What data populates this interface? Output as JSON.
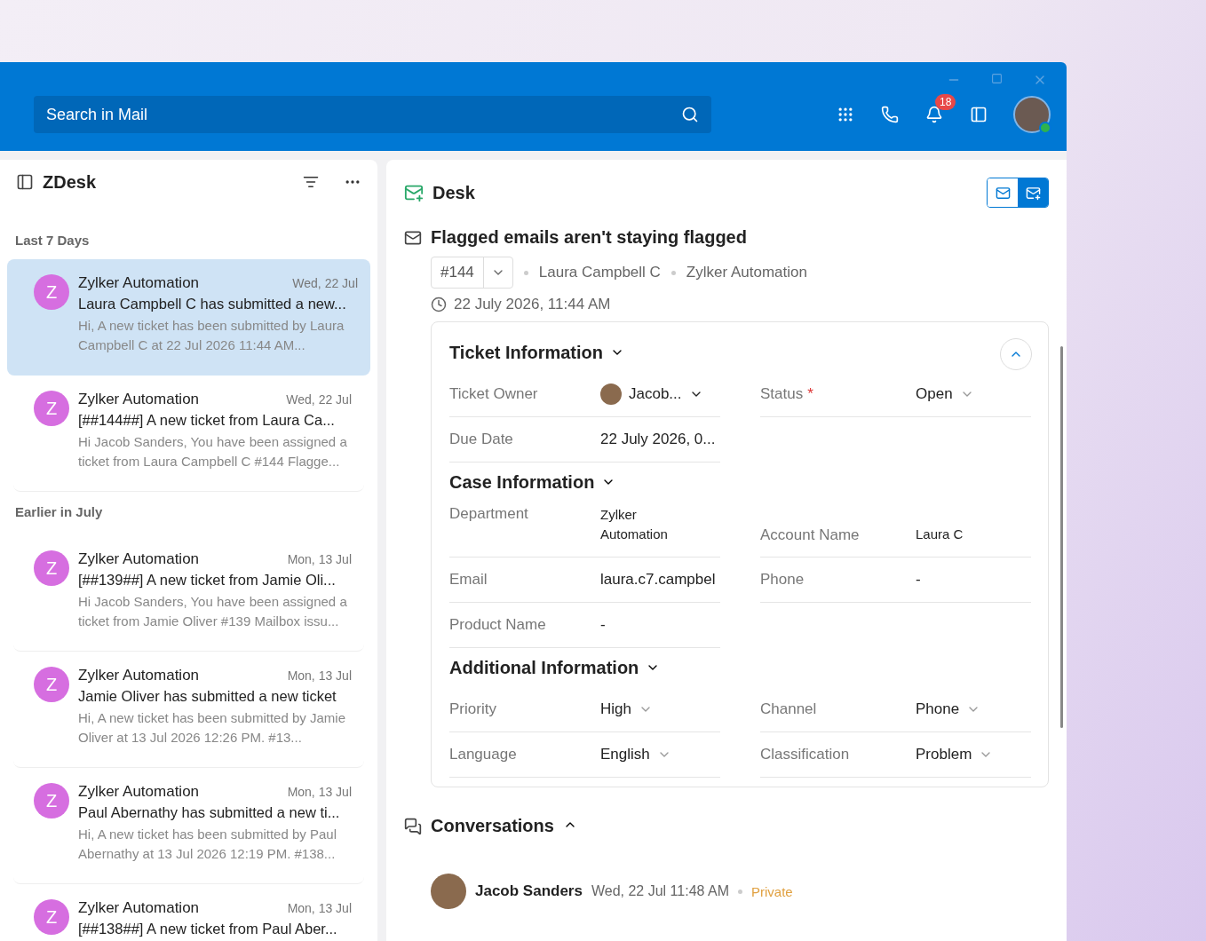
{
  "window": {
    "search": {
      "placeholder": "Search in Mail"
    },
    "notifications": {
      "count": "18"
    },
    "presence": {
      "online": true
    }
  },
  "folder": {
    "title": "ZDesk"
  },
  "mail_groups": [
    {
      "label": "Last 7 Days",
      "items": [
        {
          "avatar": "Z",
          "sender": "Zylker Automation",
          "date": "Wed, 22 Jul",
          "subject": "Laura Campbell C has submitted a new...",
          "preview": "Hi, A new ticket has been submitted by Laura Campbell C at 22 Jul 2026 11:44 AM...",
          "selected": true
        },
        {
          "avatar": "Z",
          "sender": "Zylker Automation",
          "date": "Wed, 22 Jul",
          "subject": "[##144##] A new ticket from Laura Ca...",
          "preview": "Hi Jacob Sanders, You have been assigned a ticket from Laura Campbell C #144 Flagge...",
          "selected": false
        }
      ]
    },
    {
      "label": "Earlier in July",
      "items": [
        {
          "avatar": "Z",
          "sender": "Zylker Automation",
          "date": "Mon, 13 Jul",
          "subject": "[##139##] A new ticket from Jamie Oli...",
          "preview": "Hi Jacob Sanders, You have been assigned a ticket from Jamie Oliver #139 Mailbox issu...",
          "selected": false
        },
        {
          "avatar": "Z",
          "sender": "Zylker Automation",
          "date": "Mon, 13 Jul",
          "subject": "Jamie Oliver has submitted a new ticket",
          "preview": "Hi, A new ticket has been submitted by Jamie Oliver at 13 Jul 2026 12:26 PM. #13...",
          "selected": false
        },
        {
          "avatar": "Z",
          "sender": "Zylker Automation",
          "date": "Mon, 13 Jul",
          "subject": "Paul Abernathy has submitted a new ti...",
          "preview": "Hi, A new ticket has been submitted by Paul Abernathy at 13 Jul 2026 12:19 PM. #138...",
          "selected": false
        },
        {
          "avatar": "Z",
          "sender": "Zylker Automation",
          "date": "Mon, 13 Jul",
          "subject": "[##138##] A new ticket from Paul Aber...",
          "selected": false
        }
      ]
    }
  ],
  "desk": {
    "title": "Desk",
    "view_toggle": [
      {
        "kind": "mail",
        "selected": false
      },
      {
        "kind": "desk",
        "selected": true
      }
    ],
    "ticket": {
      "subject": "Flagged emails aren't staying flagged",
      "number": "#144",
      "contact": "Laura Campbell C",
      "account": "Zylker Automation",
      "created": "22 July 2026, 11:44 AM"
    },
    "sections": [
      {
        "title": "Ticket Information",
        "rows": [
          [
            {
              "label": "Ticket Owner",
              "value": "Jacob...",
              "kind": "person"
            },
            {
              "label": "Status",
              "required_mark": "*",
              "value": "Open",
              "kind": "select"
            }
          ],
          [
            {
              "label": "Due Date",
              "value": "22 July 2026, 0...",
              "kind": "text"
            }
          ]
        ]
      },
      {
        "title": "Case Information",
        "rows": [
          [
            {
              "label": "Department",
              "value": "Zylker Automation",
              "kind": "small"
            },
            {
              "label": "Account Name",
              "value": "Laura C",
              "kind": "small"
            }
          ],
          [
            {
              "label": "Email",
              "value": "laura.c7.campbel",
              "kind": "text"
            },
            {
              "label": "Phone",
              "value": "-",
              "kind": "text"
            }
          ],
          [
            {
              "label": "Product Name",
              "value": "-",
              "kind": "text"
            }
          ]
        ]
      },
      {
        "title": "Additional Information",
        "rows": [
          [
            {
              "label": "Priority",
              "value": "High",
              "kind": "select"
            },
            {
              "label": "Channel",
              "value": "Phone",
              "kind": "select"
            }
          ],
          [
            {
              "label": "Language",
              "value": "English",
              "kind": "select"
            },
            {
              "label": "Classification",
              "value": "Problem",
              "kind": "select"
            }
          ]
        ]
      }
    ],
    "conversations": {
      "title": "Conversations",
      "expanded": true,
      "items": [
        {
          "author": "Jacob Sanders",
          "time": "Wed, 22 Jul 11:48 AM",
          "visibility": "Private"
        }
      ]
    }
  }
}
